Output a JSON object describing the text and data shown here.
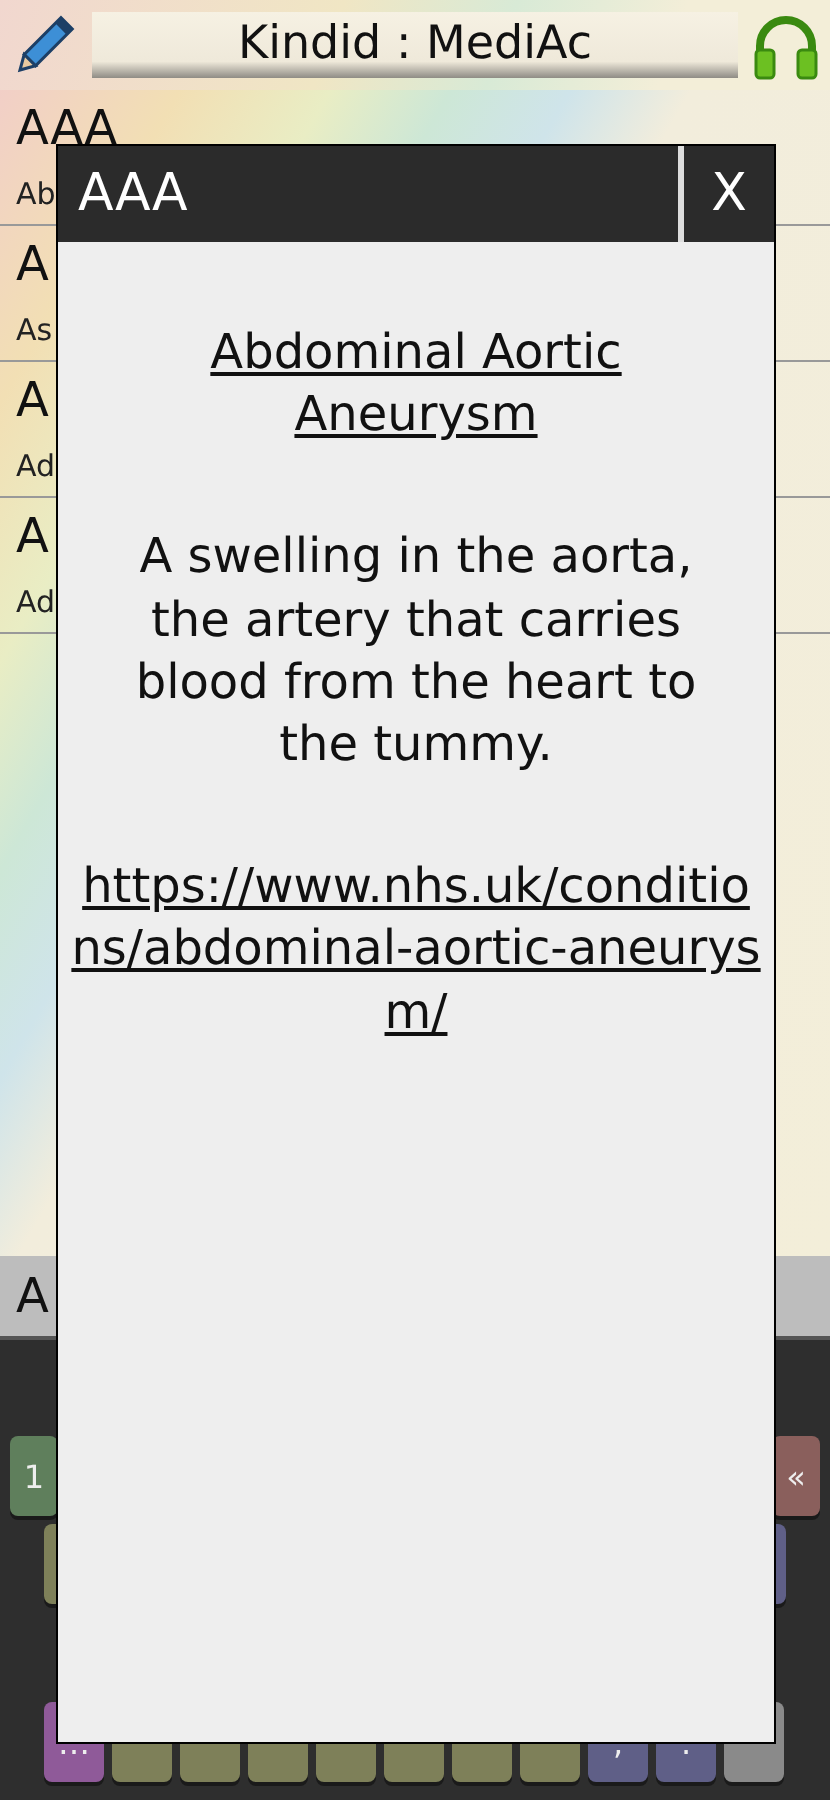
{
  "header": {
    "title": "Kindid : MediAc"
  },
  "list": [
    {
      "title": "AAA",
      "subtitle": "Ab"
    },
    {
      "title": "A",
      "subtitle": "As"
    },
    {
      "title": "A",
      "subtitle": "Ad"
    },
    {
      "title": "A",
      "subtitle": "Ad"
    }
  ],
  "search": {
    "value": "A"
  },
  "keyboard": {
    "rows": [
      [
        {
          "kind": "number",
          "label": "1"
        },
        {
          "kind": "delete",
          "label": "«"
        }
      ],
      [
        {
          "kind": "letter"
        },
        {
          "kind": "symbol"
        }
      ],
      [
        {
          "kind": "more",
          "label": "…"
        },
        {
          "kind": "letter"
        },
        {
          "kind": "letter"
        },
        {
          "kind": "letter"
        },
        {
          "kind": "letter"
        },
        {
          "kind": "letter"
        },
        {
          "kind": "letter"
        },
        {
          "kind": "letter"
        },
        {
          "kind": "symbol",
          "label": ","
        },
        {
          "kind": "symbol",
          "label": "."
        },
        {
          "kind": "enter"
        }
      ]
    ]
  },
  "dialog": {
    "title": "AAA",
    "close": "X",
    "heading": "Abdominal Aortic Aneurysm",
    "description": "A swelling in the aorta, the artery that carries blood from the heart to the tummy.",
    "link": "https://www.nhs.uk/conditions/abdominal-aortic-aneurysm/"
  }
}
